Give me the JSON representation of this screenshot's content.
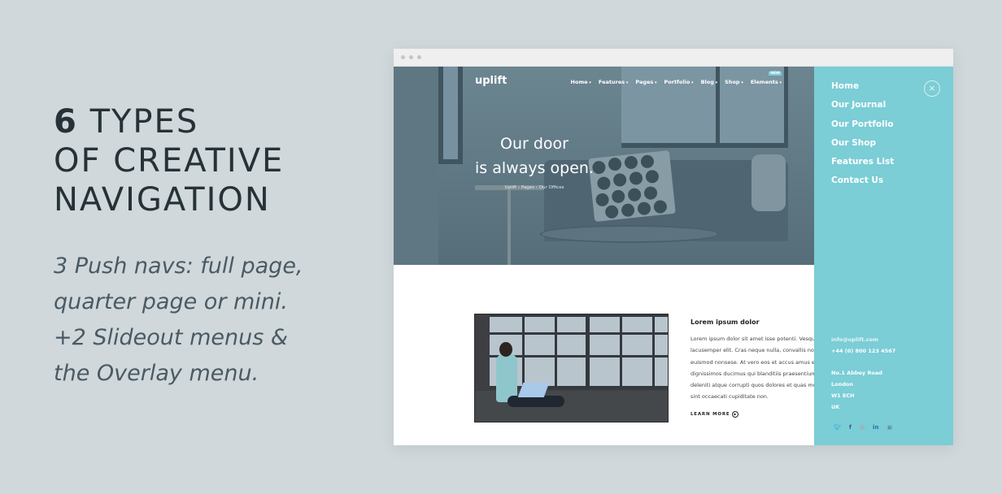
{
  "promo": {
    "headline_number": "6",
    "headline_line1_rest": "TYPES",
    "headline_line2": "OF CREATIVE",
    "headline_line3": "NAVIGATION",
    "description_lines": [
      "3 Push navs: full page,",
      "quarter page or mini.",
      "+2 Slideout menus &",
      "the Overlay menu."
    ]
  },
  "site": {
    "logo": "uplift",
    "nav": [
      "Home",
      "Features",
      "Pages",
      "Portfolio",
      "Blog",
      "Shop",
      "Elements"
    ],
    "new_badge": "NEW",
    "hero": {
      "title_line1": "Our door",
      "title_line2": "is always open.",
      "breadcrumb": [
        "Uplift",
        "Pages",
        "Our Offices"
      ],
      "breadcrumb_separator": "›"
    },
    "article": {
      "title": "Lorem ipsum dolor",
      "body_lines": [
        "Lorem ipsum dolor sit amet isse potenti. Vesqu",
        "lacusemper elit. Cras neque nulla, convallis non",
        "euismod nonsese. At vero eos et accus amus et",
        "dignissimos ducimus qui blanditiis praesentium",
        "deleniti atque corrupti quos dolores et quas mo",
        "sint occaecati cupiditate non."
      ],
      "learn_more": "LEARN MORE"
    }
  },
  "slideout": {
    "menu": [
      "Home",
      "Our Journal",
      "Our Portfolio",
      "Our Shop",
      "Features List",
      "Contact Us"
    ],
    "close_icon": "×",
    "email": "info@uplift.com",
    "phone": "+44 (0) 800 123 4567",
    "address": [
      "No.1 Abbey Road",
      "London",
      "W1 ECH",
      "UK"
    ],
    "socials": [
      {
        "name": "twitter",
        "glyph": "🐦︎",
        "color": "#3aaee4"
      },
      {
        "name": "facebook",
        "glyph": "f",
        "color": "#3b5a9a"
      },
      {
        "name": "dribbble",
        "glyph": "◎",
        "color": "#e07aa6"
      },
      {
        "name": "linkedin",
        "glyph": "in",
        "color": "#2d6fa9"
      },
      {
        "name": "instagram",
        "glyph": "▣",
        "color": "#5c8fb0"
      }
    ]
  },
  "colors": {
    "background": "#d0d8dc",
    "slideout": "#7bcdd6",
    "headline": "#263238"
  }
}
